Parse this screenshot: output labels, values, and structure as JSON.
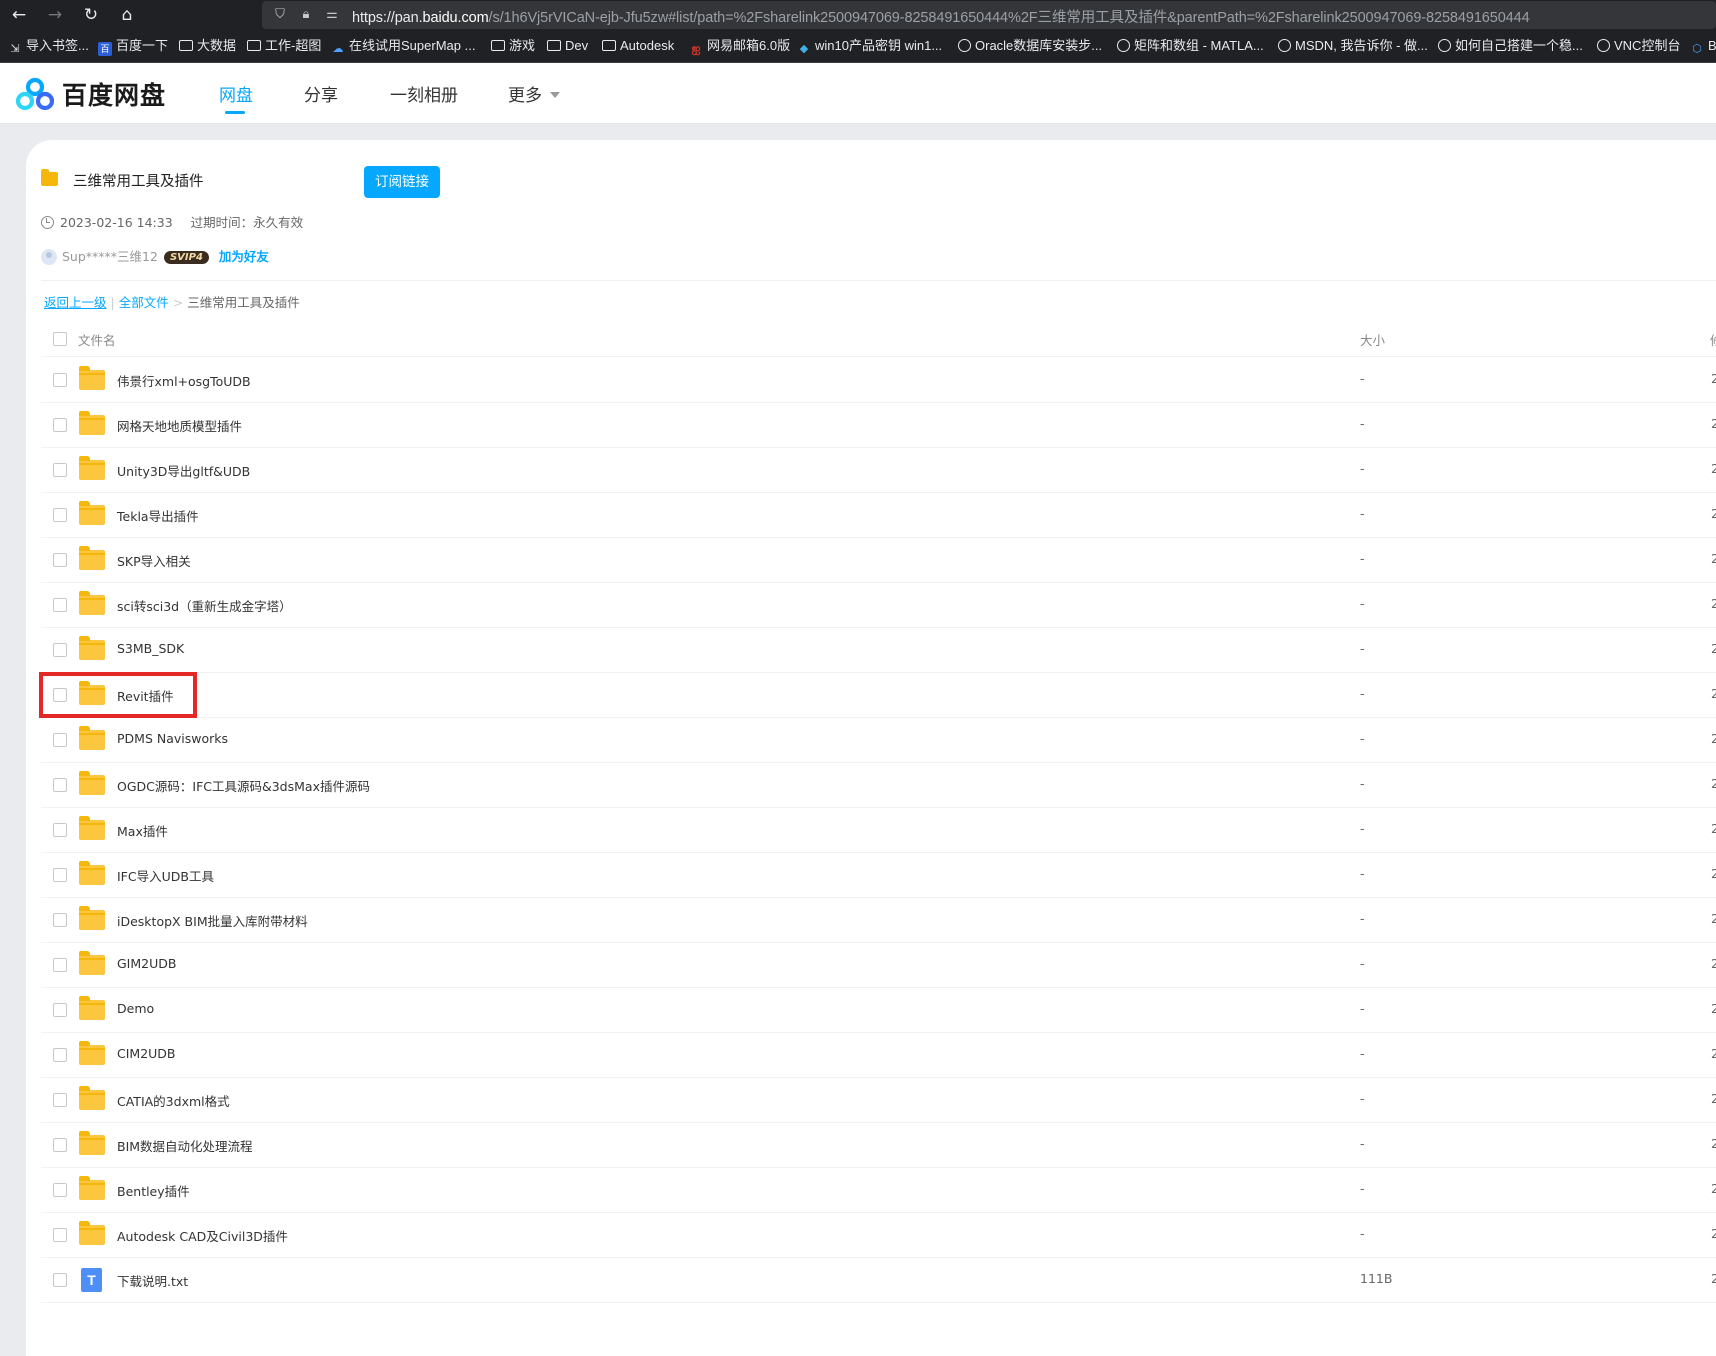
{
  "browser": {
    "url_prefix": "https://pan.",
    "url_host": "baidu.com",
    "url_rest": "/s/1h6Vj5rVICaN-ejb-Jfu5zw#list/path=%2Fsharelink2500947069-8258491650444%2F三维常用工具及插件&parentPath=%2Fsharelink2500947069-8258491650444",
    "bookmarks": [
      {
        "label": "导入书签...",
        "icon": "import-icon"
      },
      {
        "label": "百度一下",
        "icon": "baidu-icon"
      },
      {
        "label": "大数据",
        "icon": "folder-icon"
      },
      {
        "label": "工作-超图",
        "icon": "folder-icon"
      },
      {
        "label": "在线试用SuperMap ...",
        "icon": "cloud-icon"
      },
      {
        "label": "游戏",
        "icon": "folder-icon"
      },
      {
        "label": "Dev",
        "icon": "folder-icon"
      },
      {
        "label": "Autodesk",
        "icon": "folder-icon"
      },
      {
        "label": "网易邮箱6.0版",
        "icon": "netease-icon"
      },
      {
        "label": "win10产品密钥 win1...",
        "icon": "win-icon"
      },
      {
        "label": "Oracle数据库安装步...",
        "icon": "globe-icon"
      },
      {
        "label": "矩阵和数组 - MATLA...",
        "icon": "globe-icon"
      },
      {
        "label": "MSDN, 我告诉你 - 做...",
        "icon": "globe-icon"
      },
      {
        "label": "如何自己搭建一个稳...",
        "icon": "globe-icon"
      },
      {
        "label": "VNC控制台",
        "icon": "globe-icon"
      },
      {
        "label": "B",
        "icon": "app-icon"
      }
    ]
  },
  "app": {
    "logo_text": "百度网盘",
    "nav": {
      "netdisk": "网盘",
      "share": "分享",
      "album": "一刻相册",
      "more": "更多"
    }
  },
  "share": {
    "title": "三维常用工具及插件",
    "subscribe_label": "订阅链接",
    "date": "2023-02-16 14:33",
    "expire": "过期时间：永久有效",
    "user": "Sup*****三维12",
    "vip_badge": "SVIP4",
    "add_friend": "加为好友"
  },
  "breadcrumb": {
    "back": "返回上一级",
    "all_files": "全部文件",
    "current": "三维常用工具及插件"
  },
  "table": {
    "col_name": "文件名",
    "col_size": "大小",
    "col_date": "修",
    "rows": [
      {
        "name": "伟景行xml+osgToUDB",
        "size": "-",
        "date": "2",
        "type": "folder"
      },
      {
        "name": "网格天地地质模型插件",
        "size": "-",
        "date": "2",
        "type": "folder"
      },
      {
        "name": "Unity3D导出gltf&UDB",
        "size": "-",
        "date": "2",
        "type": "folder"
      },
      {
        "name": "Tekla导出插件",
        "size": "-",
        "date": "2",
        "type": "folder"
      },
      {
        "name": "SKP导入相关",
        "size": "-",
        "date": "2",
        "type": "folder"
      },
      {
        "name": "sci转sci3d（重新生成金字塔）",
        "size": "-",
        "date": "2",
        "type": "folder"
      },
      {
        "name": "S3MB_SDK",
        "size": "-",
        "date": "2",
        "type": "folder"
      },
      {
        "name": "Revit插件",
        "size": "-",
        "date": "2",
        "type": "folder"
      },
      {
        "name": "PDMS Navisworks",
        "size": "-",
        "date": "2",
        "type": "folder"
      },
      {
        "name": "OGDC源码：IFC工具源码&3dsMax插件源码",
        "size": "-",
        "date": "2",
        "type": "folder"
      },
      {
        "name": "Max插件",
        "size": "-",
        "date": "2",
        "type": "folder"
      },
      {
        "name": "IFC导入UDB工具",
        "size": "-",
        "date": "2",
        "type": "folder"
      },
      {
        "name": "iDesktopX BIM批量入库附带材料",
        "size": "-",
        "date": "2",
        "type": "folder"
      },
      {
        "name": "GIM2UDB",
        "size": "-",
        "date": "2",
        "type": "folder"
      },
      {
        "name": "Demo",
        "size": "-",
        "date": "2",
        "type": "folder"
      },
      {
        "name": "CIM2UDB",
        "size": "-",
        "date": "2",
        "type": "folder"
      },
      {
        "name": "CATIA的3dxml格式",
        "size": "-",
        "date": "2",
        "type": "folder"
      },
      {
        "name": "BIM数据自动化处理流程",
        "size": "-",
        "date": "2",
        "type": "folder"
      },
      {
        "name": "Bentley插件",
        "size": "-",
        "date": "2",
        "type": "folder"
      },
      {
        "name": "Autodesk CAD及Civil3D插件",
        "size": "-",
        "date": "2",
        "type": "folder"
      },
      {
        "name": "下载说明.txt",
        "size": "111B",
        "date": "2",
        "type": "txt"
      }
    ]
  },
  "colors": {
    "accent": "#06a7ff",
    "folder": "#fcc73f",
    "highlight": "#e42727"
  }
}
